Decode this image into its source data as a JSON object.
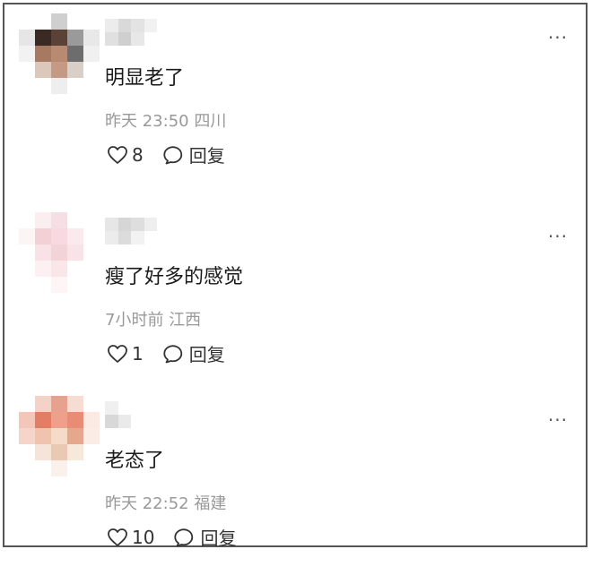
{
  "comments": [
    {
      "text": "明显老了",
      "time": "昨天 23:50",
      "location": "四川",
      "likes": "8",
      "reply_label": "回复",
      "more_icon": "···"
    },
    {
      "text": "瘦了好多的感觉",
      "time": "7小时前",
      "location": "江西",
      "likes": "1",
      "reply_label": "回复",
      "more_icon": "···"
    },
    {
      "text": "老态了",
      "time": "昨天 22:52",
      "location": "福建",
      "likes": "10",
      "reply_label": "回复",
      "more_icon": "···"
    }
  ],
  "icons": {
    "like": "heart-outline-icon",
    "reply": "speech-bubble-icon",
    "more": "more-dots-icon"
  },
  "colors": {
    "text": "#1a1a1a",
    "meta": "#999999",
    "action": "#333333",
    "border": "#555555"
  }
}
